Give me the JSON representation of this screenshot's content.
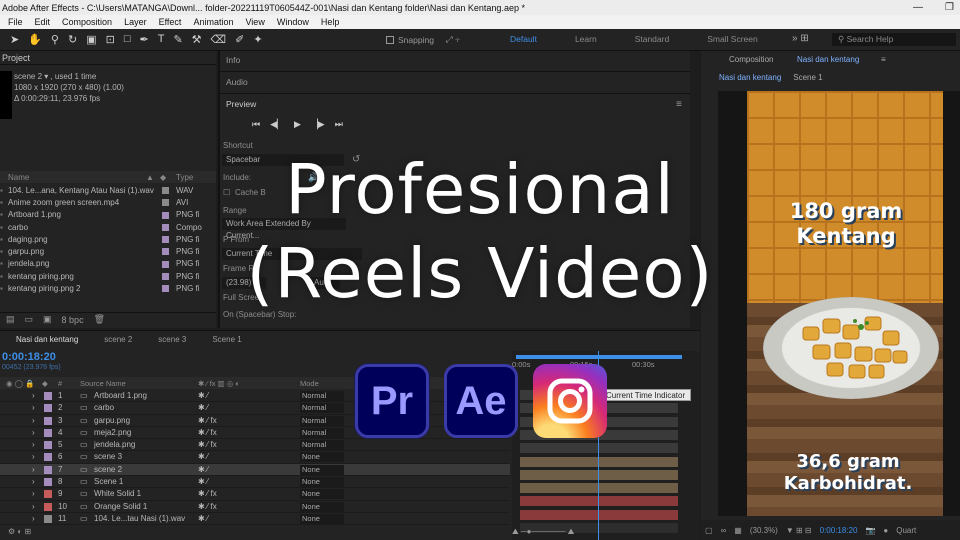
{
  "window": {
    "title": "Adobe After Effects - C:\\Users\\MATANGA\\Downl... folder-20221119T060544Z-001\\Nasi dan Kentang folder\\Nasi dan Kentang.aep *",
    "controls": [
      "—",
      "❐",
      "✕"
    ]
  },
  "menu": [
    "File",
    "Edit",
    "Composition",
    "Layer",
    "Effect",
    "Animation",
    "View",
    "Window",
    "Help"
  ],
  "toolbar": {
    "snapping_label": "Snapping",
    "workspaces": [
      "Default",
      "Learn",
      "Standard",
      "Small Screen"
    ],
    "active_workspace": "Default",
    "search_placeholder": "Search Help"
  },
  "project": {
    "title": "Project",
    "selected_item": "scene 2 ▾ , used 1 time",
    "info_line1": "1080 x 1920  (270 x 480) (1.00)",
    "info_line2": "Δ 0:00:29:11, 23.976 fps",
    "col_name": "Name",
    "col_type": "Type",
    "bpc": "8 bpc",
    "items": [
      {
        "name": "104. Le...ana, Kentang Atau Nasi (1).wav",
        "type": "WAV",
        "color": "#8a8a8a"
      },
      {
        "name": "Anime zoom green screen.mp4",
        "type": "AVI",
        "color": "#8a8a8a"
      },
      {
        "name": "Artboard 1.png",
        "type": "PNG fi",
        "color": "#a48cbd"
      },
      {
        "name": "carbo",
        "type": "Compo",
        "color": "#a48cbd"
      },
      {
        "name": "daging.png",
        "type": "PNG fi",
        "color": "#a48cbd"
      },
      {
        "name": "garpu.png",
        "type": "PNG fi",
        "color": "#a48cbd"
      },
      {
        "name": "jendela.png",
        "type": "PNG fi",
        "color": "#a48cbd"
      },
      {
        "name": "kentang piring.png",
        "type": "PNG fi",
        "color": "#a48cbd"
      },
      {
        "name": "kentang piring.png 2",
        "type": "PNG fi",
        "color": "#a48cbd"
      }
    ]
  },
  "middle": {
    "info_tab": "Info",
    "audio_tab": "Audio",
    "preview_tab": "Preview",
    "shortcut_label": "Shortcut",
    "shortcut_value": "Spacebar",
    "include_label": "Include:",
    "cache_label": "Cache B",
    "range_label": "Range",
    "range_value": "Work Area Extended By Current...",
    "play_from_label": "P     From",
    "play_from_value": "Current Time",
    "frame_rate_label": "Frame R",
    "frame_rate_value": "(23.98)",
    "auto_label": "Auto",
    "full_screen_label": "Full Screen",
    "stop_label": "On (Spacebar) Stop:"
  },
  "composition": {
    "title": "Composition",
    "comp_name": "Nasi dan kentang",
    "tabs": [
      "Nasi dan kentang",
      "Scene 1"
    ],
    "zoom": "(30.3%)",
    "timecode": "0:00:18:20",
    "quality": "Quart"
  },
  "reel": {
    "text_top_1": "180 gram",
    "text_top_2": "Kentang",
    "text_bottom_1": "36,6 gram",
    "text_bottom_2": "Karbohidrat."
  },
  "tooltip": "Current Time Indicator",
  "timeline": {
    "tabs": [
      "Nasi dan kentang",
      "scene 2",
      "scene 3",
      "Scene 1"
    ],
    "timecode": "0:00:18:20",
    "fps": "00452 (23.976 fps)",
    "header_source": "Source Name",
    "header_mode": "Mode",
    "ruler": [
      "0:00s",
      "00:15s",
      "00:30s"
    ],
    "layers": [
      {
        "num": "1",
        "name": "Artboard 1.png",
        "mode": "Normal",
        "color": "#a48cbd",
        "bar": "#3a3a3a"
      },
      {
        "num": "2",
        "name": "carbo",
        "mode": "Normal",
        "color": "#a48cbd",
        "bar": "#3a3a3a"
      },
      {
        "num": "3",
        "name": "garpu.png",
        "mode": "Normal",
        "color": "#a48cbd",
        "bar": "#3a3a3a"
      },
      {
        "num": "4",
        "name": "meja2.png",
        "mode": "Normal",
        "color": "#a48cbd",
        "bar": "#3a3a3a"
      },
      {
        "num": "5",
        "name": "jendela.png",
        "mode": "Normal",
        "color": "#a48cbd",
        "bar": "#3a3a3a"
      },
      {
        "num": "6",
        "name": "scene 3",
        "mode": "None",
        "color": "#a48cbd",
        "bar": "#6e5e48"
      },
      {
        "num": "7",
        "name": "scene 2",
        "mode": "None",
        "color": "#a48cbd",
        "bar": "#6e5e48"
      },
      {
        "num": "8",
        "name": "Scene 1",
        "mode": "None",
        "color": "#a48cbd",
        "bar": "#6e5e48"
      },
      {
        "num": "9",
        "name": "White Solid 1",
        "mode": "None",
        "color": "#c45c5c",
        "bar": "#8a3a3a"
      },
      {
        "num": "10",
        "name": "Orange Solid 1",
        "mode": "None",
        "color": "#c45c5c",
        "bar": "#8a3a3a"
      },
      {
        "num": "11",
        "name": "104. Le...tau Nasi (1).wav",
        "mode": "None",
        "color": "#8a8a8a",
        "bar": "#2d2d2d"
      }
    ],
    "selected_layer": "7"
  },
  "overlay": {
    "headline_line1": "Profesional",
    "headline_line2": "(Reels Video)",
    "app_icons": [
      {
        "name": "premiere-pro-icon",
        "label": "Pr"
      },
      {
        "name": "after-effects-icon",
        "label": "Ae"
      },
      {
        "name": "instagram-icon",
        "label": ""
      }
    ]
  }
}
